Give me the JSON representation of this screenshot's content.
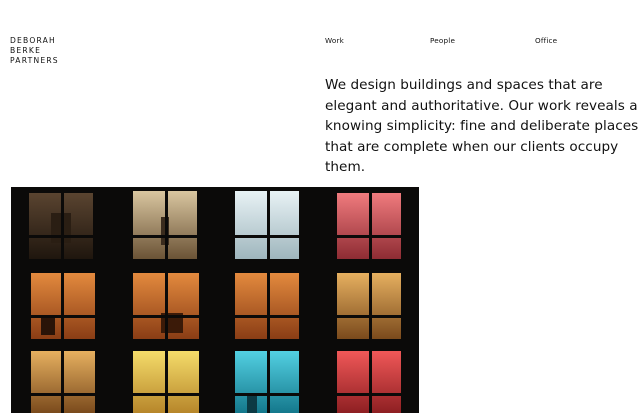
{
  "brand": {
    "lines": [
      "DEBORAH",
      "BERKE",
      "PARTNERS"
    ]
  },
  "nav": {
    "work": "Work",
    "people": "People",
    "office": "Office"
  },
  "intro": "We design buildings and spaces that are elegant and authoritative. Our work reveals a knowing simplicity: fine and deliberate places that are complete when our clients occupy them.",
  "hero": {
    "subject": "building facade at night with lit windows",
    "colors": {
      "dark": "#0b0a09",
      "orange": "#c46a2c",
      "amber": "#d79a3c",
      "yellow": "#e8c547",
      "white_blue": "#cfe2ea",
      "cyan": "#2fb0c7",
      "red": "#d84545",
      "pink": "#d8606a"
    }
  }
}
